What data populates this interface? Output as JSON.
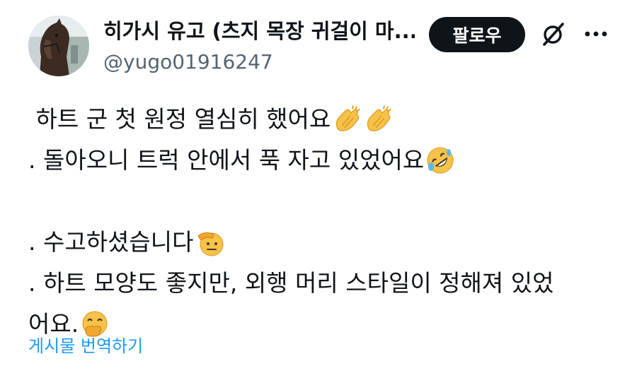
{
  "author": {
    "display_name": "히가시 유고 (츠지 목장 귀걸이 마...",
    "handle": "@yugo01916247",
    "avatar_icon": "horse-photo"
  },
  "actions": {
    "follow_label": "팔로우",
    "grok_icon": "grok-icon",
    "more_icon": "more-icon"
  },
  "tweet": {
    "lines": [
      " 하트 군 첫 원정 열심히 했어요",
      ". 돌아오니 트럭 안에서 푹 자고 있었어요",
      "",
      ". 수고하셨습니다",
      ". 하트 모양도 좋지만, 외행 머리 스타일이 정해져 있었",
      "어요."
    ],
    "emojis": {
      "line0": [
        "clapping-hands-emoji",
        "clapping-hands-emoji"
      ],
      "line1": [
        "rolling-laughing-emoji"
      ],
      "line3": [
        "saluting-face-emoji"
      ],
      "line5": [
        "hand-over-mouth-emoji"
      ]
    }
  },
  "translate_label": "게시물 번역하기",
  "colors": {
    "text": "#0f1419",
    "secondary": "#536471",
    "link": "#1d9bf0",
    "button_bg": "#0f1419"
  }
}
